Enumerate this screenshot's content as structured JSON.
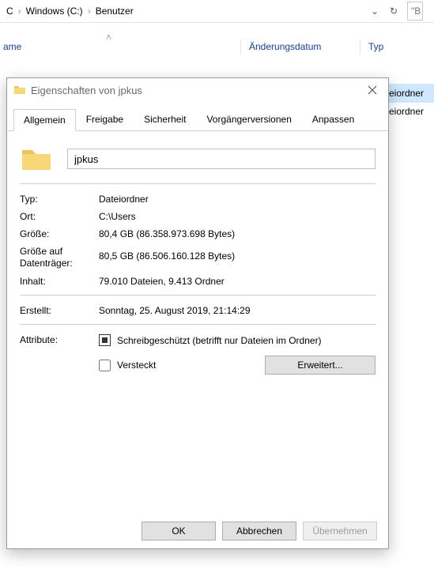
{
  "explorer": {
    "crumbs": [
      "C",
      "Windows (C:)",
      "Benutzer"
    ],
    "refresh_icon": "↻",
    "search_placeholder": "\"B",
    "columns": {
      "name": "ame",
      "modified": "Änderungsdatum",
      "type": "Typ"
    },
    "rows": [
      "eiordner",
      "eiordner"
    ]
  },
  "dialog": {
    "title": "Eigenschaften von jpkus",
    "tabs": [
      {
        "label": "Allgemein",
        "active": true
      },
      {
        "label": "Freigabe",
        "active": false
      },
      {
        "label": "Sicherheit",
        "active": false
      },
      {
        "label": "Vorgängerversionen",
        "active": false
      },
      {
        "label": "Anpassen",
        "active": false
      }
    ],
    "name_value": "jpkus",
    "rows": {
      "typ_label": "Typ:",
      "typ_value": "Dateiordner",
      "ort_label": "Ort:",
      "ort_value": "C:\\Users",
      "groesse_label": "Größe:",
      "groesse_value": "80,4 GB (86.358.973.698 Bytes)",
      "disk_label": "Größe auf Datenträger:",
      "disk_value": "80,5 GB (86.506.160.128 Bytes)",
      "inhalt_label": "Inhalt:",
      "inhalt_value": "79.010 Dateien, 9.413 Ordner",
      "erstellt_label": "Erstellt:",
      "erstellt_value": "Sonntag, 25. August 2019, 21:14:29",
      "attr_label": "Attribute:",
      "attr_ro": "Schreibgeschützt (betrifft nur Dateien im Ordner)",
      "attr_hidden": "Versteckt",
      "advanced_btn": "Erweitert..."
    },
    "buttons": {
      "ok": "OK",
      "cancel": "Abbrechen",
      "apply": "Übernehmen"
    }
  }
}
